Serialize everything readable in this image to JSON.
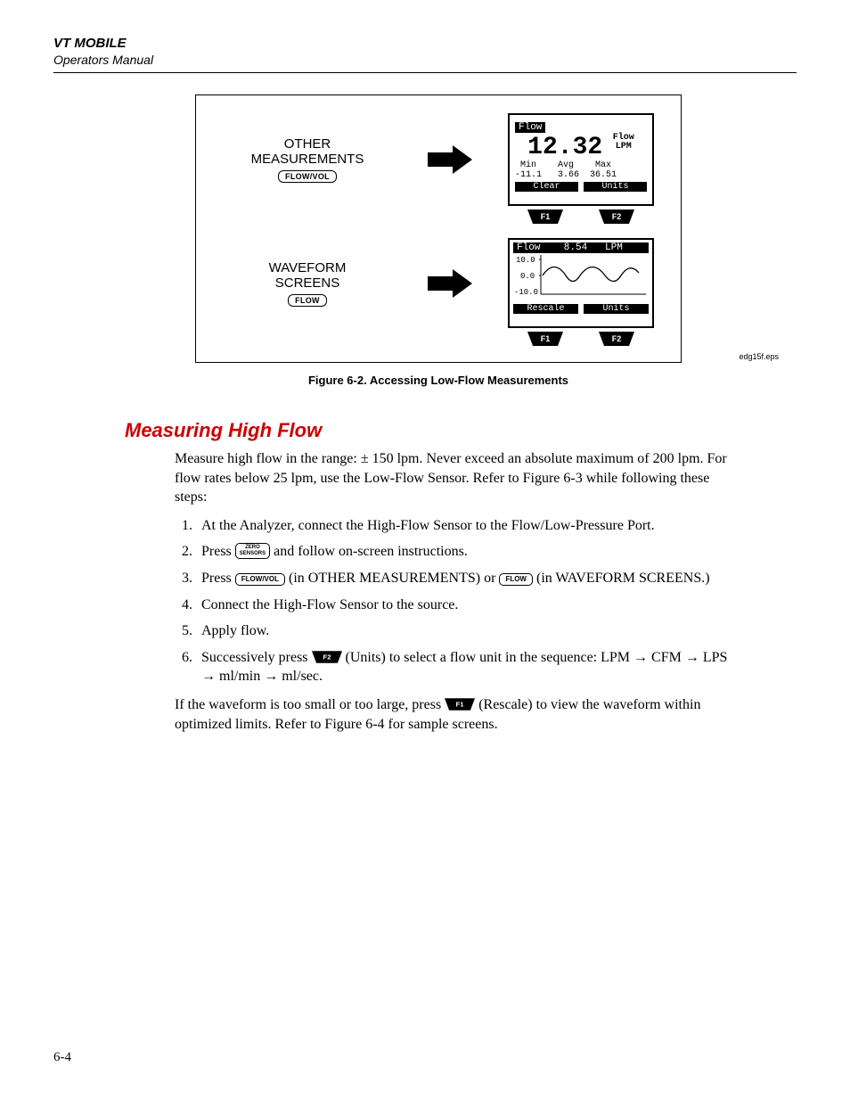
{
  "header": {
    "title": "VT MOBILE",
    "subtitle": "Operators Manual"
  },
  "figure": {
    "row1_label_line1": "OTHER",
    "row1_label_line2": "MEASUREMENTS",
    "row1_button": "FLOW/VOL",
    "row2_label_line1": "WAVEFORM",
    "row2_label_line2": "SCREENS",
    "row2_button": "FLOW",
    "screen1": {
      "title": "Flow",
      "big_value": "12.32",
      "unit_line1": "Flow",
      "unit_line2": "LPM",
      "labels": " Min    Avg    Max",
      "values": "-11.1   3.66  36.51",
      "btn_left": "Clear",
      "btn_right": "Units"
    },
    "screen2": {
      "top": "Flow    8.54   LPM",
      "y1": "10.0",
      "y2": "0.0",
      "y3": "-10.0",
      "btn_left": "Rescale",
      "btn_right": "Units"
    },
    "fkey1": "F1",
    "fkey2": "F2",
    "caption": "Figure 6-2. Accessing Low-Flow Measurements",
    "eps": "edg15f.eps"
  },
  "section_title": "Measuring High Flow",
  "body": {
    "intro": "Measure high flow in the range: ± 150 lpm. Never exceed an absolute maximum of 200 lpm. For flow rates below 25 lpm, use the Low-Flow Sensor. Refer to Figure 6-3 while following these steps:",
    "step1": "At the Analyzer, connect the High-Flow Sensor to the Flow/Low-Pressure Port.",
    "step2_a": "Press ",
    "step2_btn": "ZERO SENSORS",
    "step2_b": " and follow on-screen instructions.",
    "step3_a": "Press ",
    "step3_btn1": "FLOW/VOL",
    "step3_b": " (in OTHER MEASUREMENTS) or ",
    "step3_btn2": "FLOW",
    "step3_c": " (in WAVEFORM SCREENS.)",
    "step4": "Connect the High-Flow Sensor to the source.",
    "step5": "Apply flow.",
    "step6_a": "Successively press ",
    "step6_b": " (Units) to select a flow unit in the sequence: LPM → CFM → LPS → ml/min → ml/sec.",
    "outro_a": "If the waveform is too small or too large, press ",
    "outro_b": " (Rescale) to view the waveform within optimized limits. Refer to Figure 6-4 for sample screens."
  },
  "page_number": "6-4"
}
